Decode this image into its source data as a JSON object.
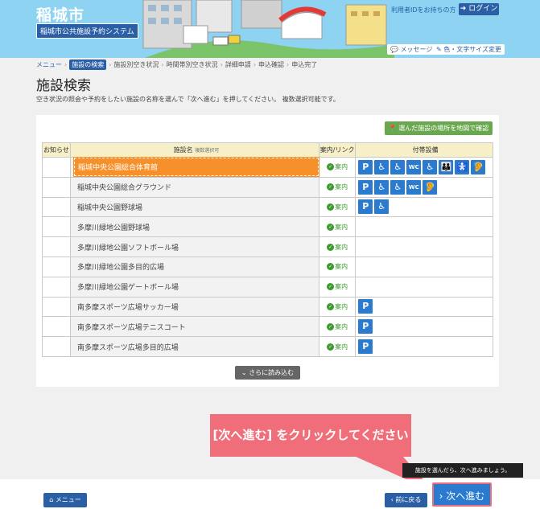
{
  "header": {
    "city_name": "稲城市",
    "system_name": "稲城市公共施設予約システム",
    "login_hint": "利用者IDをお持ちの方",
    "login_label": "ログイン",
    "message_label": "メッセージ",
    "font_label": "色・文字サイズ変更"
  },
  "breadcrumb": [
    {
      "label": "メニュー",
      "state": "link"
    },
    {
      "label": "施設の検索",
      "state": "current"
    },
    {
      "label": "施設別空き状況",
      "state": "normal"
    },
    {
      "label": "時間帯別空き状況",
      "state": "normal"
    },
    {
      "label": "詳細申請",
      "state": "normal"
    },
    {
      "label": "申込確認",
      "state": "normal"
    },
    {
      "label": "申込完了",
      "state": "normal"
    }
  ],
  "page": {
    "title": "施設検索",
    "description": "空き状況の照会や予約をしたい施設の名称を選んで「次へ進む」を押してください。 複数選択可能です。"
  },
  "map_button": "選んだ施設の場所を地図で確認",
  "table": {
    "headers": {
      "notice": "お知らせ",
      "name": "施設名",
      "name_sub": "複数選択可",
      "link": "案内/リンク",
      "equipment": "付帯設備"
    },
    "link_label": "案内",
    "rows": [
      {
        "name": "稲城中央公園総合体育館",
        "selected": true,
        "equipment": [
          "P",
          "♿",
          "♿",
          "WC",
          "♿",
          "👪",
          "🚼",
          "🦻"
        ]
      },
      {
        "name": "稲城中央公園総合グラウンド",
        "selected": false,
        "equipment": [
          "P",
          "♿",
          "♿",
          "WC",
          "🦻"
        ]
      },
      {
        "name": "稲城中央公園野球場",
        "selected": false,
        "equipment": [
          "P",
          "♿"
        ]
      },
      {
        "name": "多摩川緑地公園野球場",
        "selected": false,
        "equipment": []
      },
      {
        "name": "多摩川緑地公園ソフトボール場",
        "selected": false,
        "equipment": []
      },
      {
        "name": "多摩川緑地公園多目的広場",
        "selected": false,
        "equipment": []
      },
      {
        "name": "多摩川緑地公園ゲートボール場",
        "selected": false,
        "equipment": []
      },
      {
        "name": "南多摩スポーツ広場サッカー場",
        "selected": false,
        "equipment": [
          "P"
        ]
      },
      {
        "name": "南多摩スポーツ広場テニスコート",
        "selected": false,
        "equipment": [
          "P"
        ]
      },
      {
        "name": "南多摩スポーツ広場多目的広場",
        "selected": false,
        "equipment": [
          "P"
        ]
      }
    ]
  },
  "more_button": "さらに読み込む",
  "callout": "[次へ進む] をクリックしてください",
  "tooltip": "施設を選んだら、次へ進みましょう。",
  "footer": {
    "menu_label": "メニュー",
    "back_label": "前に戻る",
    "next_label": "次へ進む"
  },
  "colors": {
    "brand": "#2a5fa5",
    "selected": "#f5902a",
    "callout": "#f06e7a",
    "map_button": "#6aa84f"
  }
}
